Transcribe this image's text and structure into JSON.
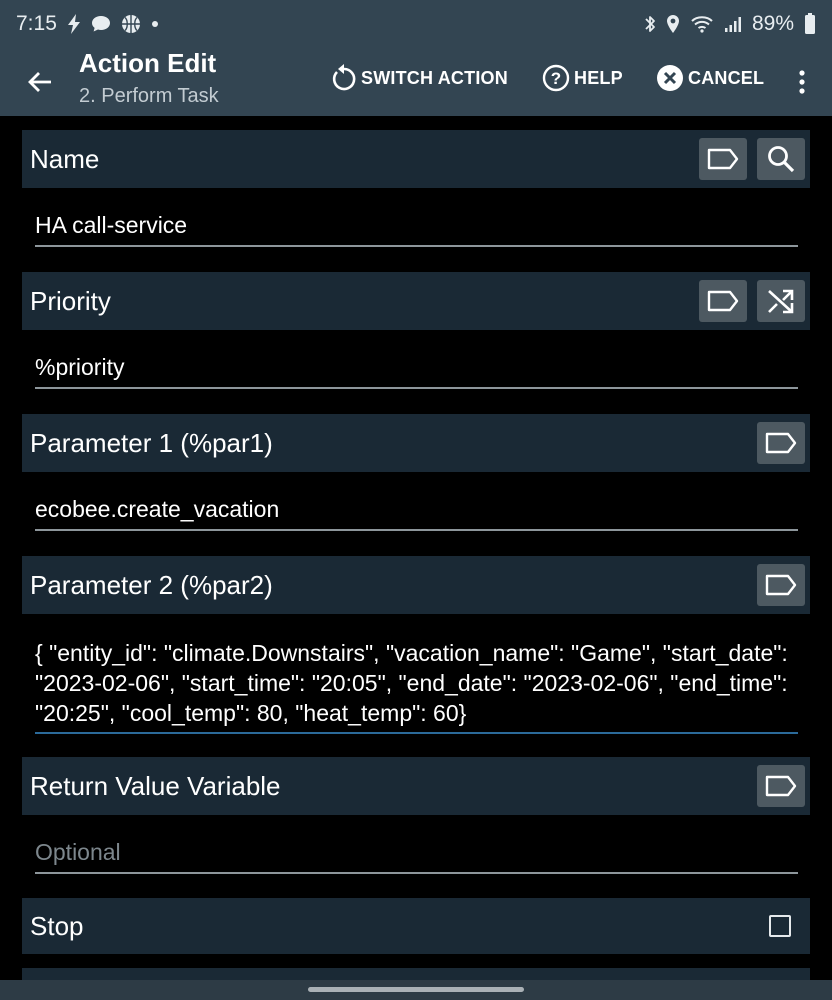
{
  "status_bar": {
    "time": "7:15",
    "battery": "89%",
    "left_icons": [
      "flash-icon",
      "chat-bubble-icon",
      "basketball-icon",
      "dot-icon"
    ],
    "right_icons": [
      "bluetooth-icon",
      "location-icon",
      "wifi-calling-icon",
      "signal-icon",
      "battery-icon"
    ]
  },
  "app_bar": {
    "title": "Action Edit",
    "subtitle": "2. Perform Task",
    "switch_action_label": "SWITCH ACTION",
    "help_label": "HELP",
    "cancel_label": "CANCEL"
  },
  "sections": {
    "name": {
      "label": "Name",
      "value": "HA call-service"
    },
    "priority": {
      "label": "Priority",
      "value": "%priority"
    },
    "param1": {
      "label": "Parameter 1 (%par1)",
      "value": "ecobee.create_vacation"
    },
    "param2": {
      "label": "Parameter 2 (%par2)",
      "value": "{ \"entity_id\": \"climate.Downstairs\", \"vacation_name\": \"Game\", \"start_date\": \"2023-02-06\", \"start_time\": \"20:05\", \"end_date\": \"2023-02-06\", \"end_time\": \"20:25\", \"cool_temp\": 80, \"heat_temp\": 60}"
    },
    "return_value": {
      "label": "Return Value Variable",
      "placeholder": "Optional"
    },
    "stop": {
      "label": "Stop",
      "checked": false
    }
  },
  "colors": {
    "app_bar": "#334552",
    "section_header": "#1a2935",
    "icon_button": "#4d5961",
    "background": "#000000",
    "active_underline": "#2b6a9a"
  }
}
